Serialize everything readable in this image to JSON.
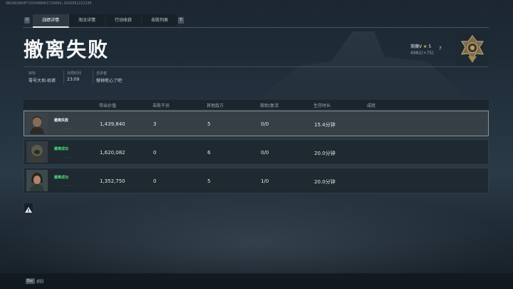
{
  "watermark": "ON1A81B84F7254308061726094,2026062222330",
  "tabs": {
    "key_left": "Q",
    "key_right": "E",
    "items": [
      {
        "label": "战绩详情"
      },
      {
        "label": "淘汰详情"
      },
      {
        "label": "行动收获"
      },
      {
        "label": "击败列表"
      }
    ]
  },
  "title": "撤离失败",
  "info": {
    "target_key": "目标",
    "target_val": "零号大坝-机密",
    "time_key": "对局时间",
    "time_val": "23:09",
    "killer_key": "击杀者",
    "killer_val": "够钟死心了吧"
  },
  "rank": {
    "name": "渐魔V",
    "stars": "5",
    "points": "4981(+75)",
    "help": "?"
  },
  "table": {
    "headers": {
      "value": "带出价值",
      "kills": "击败干员",
      "others": "其他敌方",
      "rescue": "救助/复活",
      "survive": "生存时长",
      "achieve": "成就"
    },
    "rows": [
      {
        "name": "撤离失败",
        "value": "1,439,840",
        "kills": "3",
        "others": "5",
        "rescue": "0/0",
        "survive": "15.4分钟"
      },
      {
        "name": "撤离成功",
        "value": "1,620,082",
        "kills": "0",
        "others": "6",
        "rescue": "0/0",
        "survive": "20.0分钟"
      },
      {
        "name": "撤离成功",
        "value": "1,352,750",
        "kills": "0",
        "others": "5",
        "rescue": "1/0",
        "survive": "20.0分钟"
      }
    ]
  },
  "footer": {
    "esc": "Esc",
    "back": "返回"
  },
  "colors": {
    "success": "#4fe07a",
    "star": "#e6c24a"
  }
}
